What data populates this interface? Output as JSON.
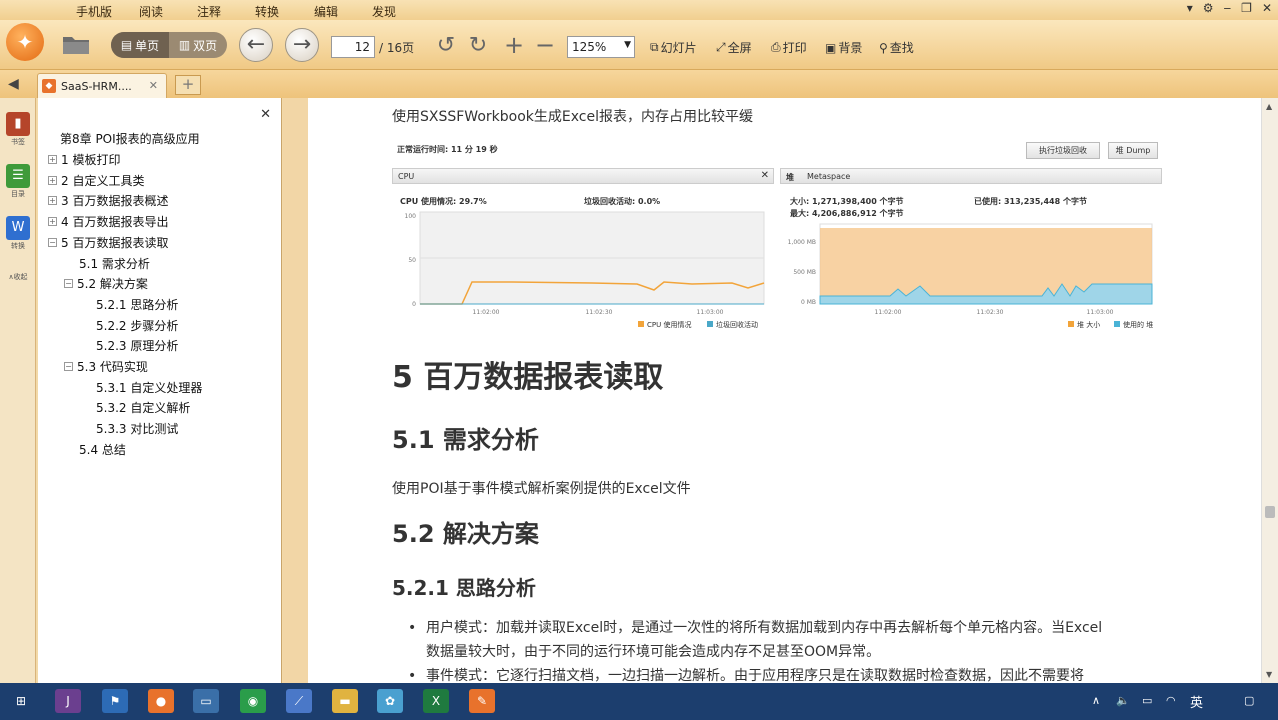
{
  "menu": {
    "items": [
      "手机版",
      "阅读",
      "注释",
      "转换",
      "编辑",
      "发现"
    ]
  },
  "window_buttons": [
    "▾",
    "⚙",
    "‒",
    "❐",
    "✕"
  ],
  "toolbar": {
    "single_page_label": "单页",
    "double_page_label": "双页",
    "current_page": "12",
    "total_pages": "/ 16页",
    "zoom_level": "125%",
    "slideshow_label": "幻灯片",
    "fullscreen_label": "全屏",
    "print_label": "打印",
    "background_label": "背景",
    "search_label": "查找"
  },
  "tab": {
    "title": "SaaS-HRM...."
  },
  "side_icons": [
    {
      "name": "bookmark",
      "label": "书签",
      "color": "#b5452a",
      "glyph": "▮"
    },
    {
      "name": "toc",
      "label": "目录",
      "color": "#3f9a3a",
      "glyph": "☰"
    },
    {
      "name": "convert",
      "label": "转换",
      "color": "#2f6fd0",
      "glyph": "W"
    }
  ],
  "side_collapse_label": "∧收起",
  "toc": {
    "items": [
      {
        "label": "第8章 POI报表的高级应用",
        "toggle": ""
      },
      {
        "label": "1 模板打印",
        "toggle": "+"
      },
      {
        "label": "2 自定义工具类",
        "toggle": "+"
      },
      {
        "label": "3 百万数据报表概述",
        "toggle": "+"
      },
      {
        "label": "4 百万数据报表导出",
        "toggle": "+"
      },
      {
        "label": "5 百万数据报表读取",
        "toggle": "−"
      },
      {
        "label": "5.1 需求分析",
        "toggle": ""
      },
      {
        "label": "5.2 解决方案",
        "toggle": "−"
      },
      {
        "label": "5.2.1 思路分析",
        "toggle": ""
      },
      {
        "label": "5.2.2 步骤分析",
        "toggle": ""
      },
      {
        "label": "5.2.3 原理分析",
        "toggle": ""
      },
      {
        "label": "5.3 代码实现",
        "toggle": "−"
      },
      {
        "label": "5.3.1 自定义处理器",
        "toggle": ""
      },
      {
        "label": "5.3.2 自定义解析",
        "toggle": ""
      },
      {
        "label": "5.3.3 对比测试",
        "toggle": ""
      },
      {
        "label": "5.4 总结",
        "toggle": ""
      }
    ]
  },
  "doc": {
    "intro_text": "使用SXSSFWorkbook生成Excel报表，内存占用比较平缓",
    "h1": "5 百万数据报表读取",
    "h2_1": "5.1 需求分析",
    "p1": "使用POI基于事件模式解析案例提供的Excel文件",
    "h2_2": "5.2 解决方案",
    "h3": "5.2.1 思路分析",
    "bullet1_line1": "用户模式：加载并读取Excel时，是通过一次性的将所有数据加载到内存中再去解析每个单元格内容。当Excel",
    "bullet1_line2": "数据量较大时，由于不同的运行环境可能会造成内存不足甚至OOM异常。",
    "bullet2_line1": "事件模式：它逐行扫描文档，一边扫描一边解析。由于应用程序只是在读取数据时检查数据，因此不需要将"
  },
  "monitor": {
    "uptime": "正常运行时间: 11 分 19 秒",
    "gc_button": "执行垃圾回收",
    "dump_button": "堆 Dump",
    "cpu_tab": "CPU",
    "heap_tab": "堆",
    "metaspace_tab": "Metaspace",
    "cpu_usage_label": "CPU 使用情况: 29.7%",
    "gc_activity_label": "垃圾回收活动: 0.0%",
    "heap_size_label": "大小: 1,271,398,400 个字节",
    "heap_max_label": "最大: 4,206,886,912 个字节",
    "heap_used_label": "已使用: 313,235,448 个字节",
    "cpu_legend": [
      "CPU 使用情况",
      "垃圾回收活动"
    ],
    "heap_legend": [
      "堆 大小",
      "使用的 堆"
    ],
    "cpu_yticks": [
      "100",
      "50",
      "0"
    ],
    "heap_yticks": [
      "1,000 MB",
      "500 MB",
      "0 MB"
    ],
    "cpu_xticks": [
      "11:02:00",
      "11:02:30",
      "11:03:00"
    ],
    "heap_xticks": [
      "11:02:00",
      "11:02:30",
      "11:03:00"
    ],
    "colors": {
      "cpu": "#f2a43a",
      "gc": "#4aa8c8",
      "heap_size": "#f6c78c",
      "heap_used": "#4ab3d6"
    }
  },
  "taskbar": {
    "apps": [
      {
        "name": "start",
        "glyph": "⊞",
        "color": "transparent"
      },
      {
        "name": "app1",
        "glyph": "J",
        "color": "#6b3f8f"
      },
      {
        "name": "app2",
        "glyph": "⚑",
        "color": "#2d6bb5"
      },
      {
        "name": "app3",
        "glyph": "●",
        "color": "#e8722c"
      },
      {
        "name": "app4",
        "glyph": "▭",
        "color": "#3a6fa8"
      },
      {
        "name": "chrome",
        "glyph": "◉",
        "color": "#2a9d4a"
      },
      {
        "name": "app6",
        "glyph": "⟋",
        "color": "#4a78c8"
      },
      {
        "name": "folder",
        "glyph": "▬",
        "color": "#e0b340"
      },
      {
        "name": "app8",
        "glyph": "✿",
        "color": "#4aa0d0"
      },
      {
        "name": "excel",
        "glyph": "X",
        "color": "#1f7a3f"
      },
      {
        "name": "app10",
        "glyph": "✎",
        "color": "#e8722c"
      }
    ],
    "ime": "英"
  }
}
